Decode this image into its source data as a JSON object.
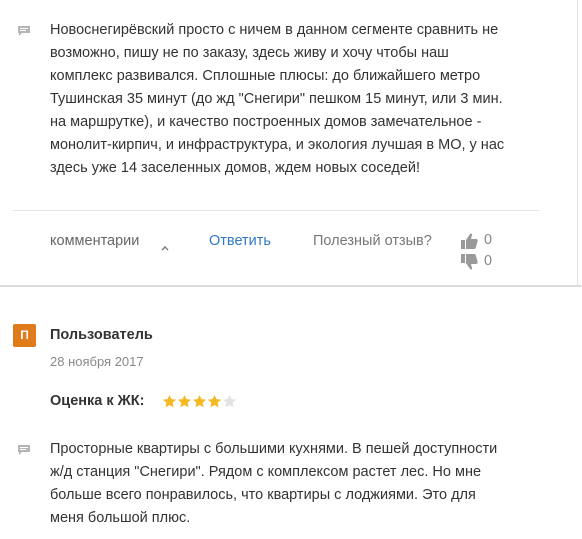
{
  "review1": {
    "lines": [
      "Новоснегирёвский просто с ничем в данном сегменте сравнить не",
      "возможно, пишу не по заказу, здесь живу и хочу чтобы наш",
      "комплекс развивался. Сплошные плюсы: до ближайшего метро",
      "Тушинская 35 минут (до жд \"Снегири\" пешком 15 минут, или 3 мин.",
      "на маршрутке), и качество построенных домов замечательное -",
      "монолит-кирпич, и инфраструктура, и экология лучшая в МО, у нас",
      "здесь уже 14 заселенных домов, ждем новых соседей!"
    ],
    "actions": {
      "comments_label": "комментарии",
      "reply_label": "Ответить",
      "helpful_label": "Полезный отзыв?",
      "likes": "0",
      "dislikes": "0"
    }
  },
  "review2": {
    "avatar_letter": "П",
    "username": "Пользователь",
    "date": "28 ноября 2017",
    "rating_label": "Оценка к ЖК:",
    "rating": 4,
    "rating_max": 5,
    "lines": [
      "Просторные квартиры с большими кухнями. В пешей доступности",
      "ж/д станция \"Снегири\". Рядом с комплексом растет лес. Но мне",
      "больше всего понравилось, что квартиры с лоджиями. Это для",
      "меня большой плюс."
    ]
  },
  "colors": {
    "star_filled": "#f5b923",
    "star_empty": "#e3e3e3",
    "avatar": "#e07b1c",
    "link": "#2f78c4"
  },
  "icons": [
    "comment-icon",
    "chevron-up-icon",
    "thumbs-up-icon",
    "thumbs-down-icon",
    "star-icon"
  ]
}
